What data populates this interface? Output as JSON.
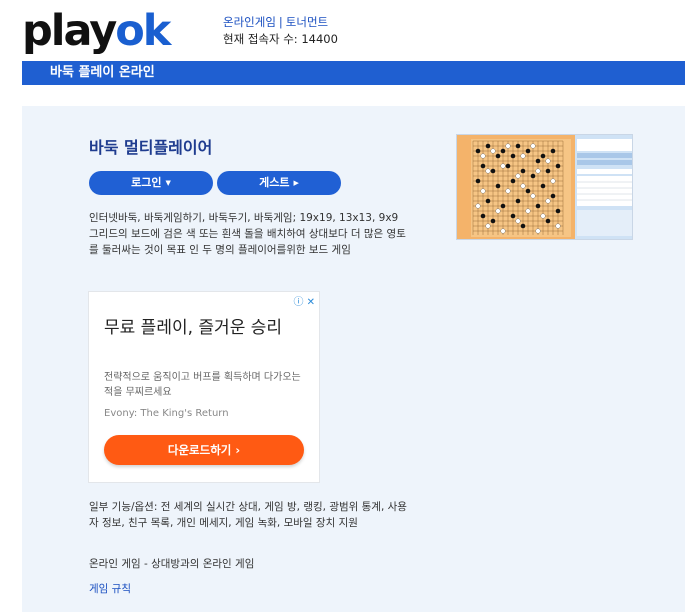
{
  "logo": {
    "part1": "play",
    "part2": "ok"
  },
  "nav": {
    "online_games": "온라인게임",
    "separator": "|",
    "tournaments": "토너먼트",
    "online_label": "현재 접속자 수:",
    "online_count": "14400"
  },
  "page_title": "바둑 플레이 온라인",
  "game": {
    "title": "바둑 멀티플레이어",
    "login_button": "로그인",
    "guest_button": "게스트",
    "description": "인터넷바둑, 바둑게임하기, 바둑두기, 바둑게임; 19x19, 13x13, 9x9 그리드의 보드에 검은 색 또는 흰색 돌을 배치하여 상대보다 더 많은 영토를 둘러싸는 것이 목표 인 두 명의 플레이어를위한 보드 게임",
    "features": "일부 기능/옵션: 전 세계의 실시간 상대, 게임 방, 랭킹, 광범위 통계, 사용자 정보, 친구 목록, 개인 메세지, 게임 녹화, 모바일 장치 지원",
    "online_line": "온라인 게임 - 상대방과의 온라인 게임",
    "rules_link": "게임 규칙"
  },
  "ad": {
    "badge": "ⓘ ✕",
    "headline": "무료 플레이, 즐거운 승리",
    "body": "전략적으로 움직이고 버프를 획득하며 다가오는 적을 무찌르세요",
    "source": "Evony: The King's Return",
    "cta": "다운로드하기  ›"
  },
  "colors": {
    "brand_blue": "#1f5fd1",
    "panel_bg": "#eef4fb",
    "cta_orange": "#ff5a13"
  }
}
